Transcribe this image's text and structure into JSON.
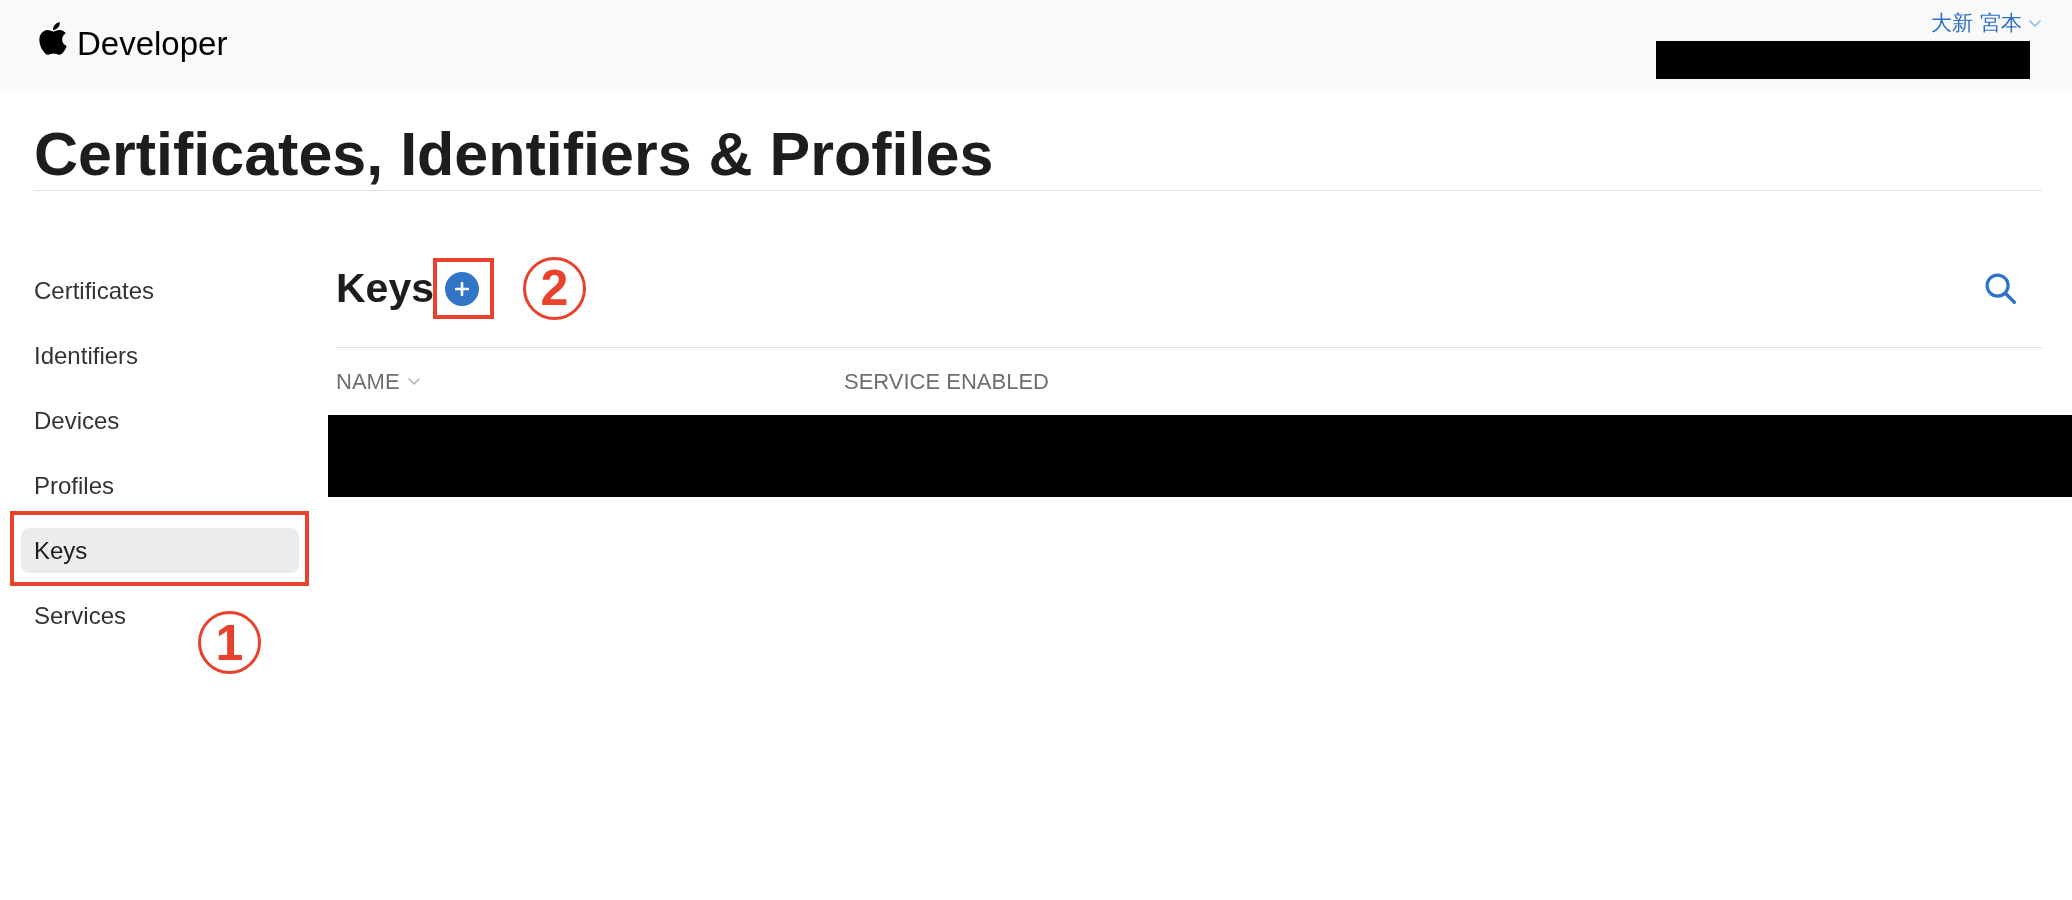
{
  "header": {
    "site_name": "Developer",
    "user": {
      "name": "大新 宮本",
      "account_redacted": true
    }
  },
  "page_title": "Certificates, Identifiers & Profiles",
  "sidebar": {
    "items": [
      {
        "label": "Certificates",
        "selected": false
      },
      {
        "label": "Identifiers",
        "selected": false
      },
      {
        "label": "Devices",
        "selected": false
      },
      {
        "label": "Profiles",
        "selected": false
      },
      {
        "label": "Keys",
        "selected": true,
        "callout": "1"
      },
      {
        "label": "Services",
        "selected": false
      }
    ]
  },
  "section": {
    "title": "Keys",
    "add_button": {
      "callout": "2"
    }
  },
  "table": {
    "columns": [
      {
        "label": "NAME",
        "sorted": true
      },
      {
        "label": "SERVICE ENABLED",
        "sorted": false
      }
    ],
    "rows": [
      {
        "redacted": true
      }
    ]
  }
}
